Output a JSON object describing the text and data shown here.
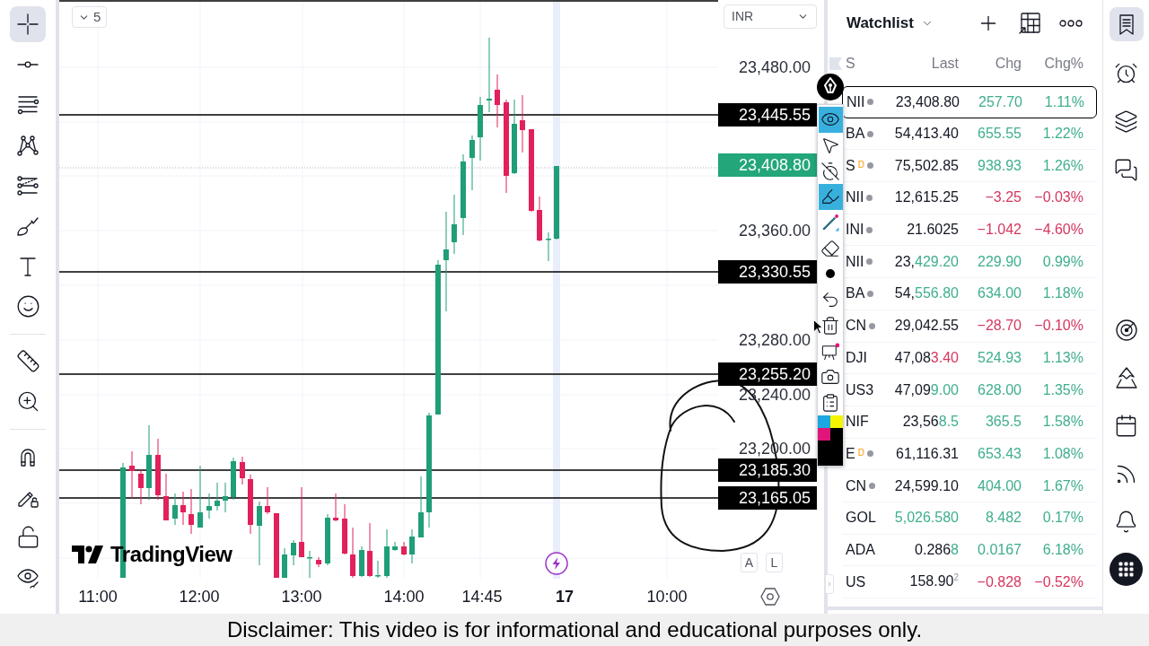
{
  "left_toolbar": {
    "groups": [
      [
        {
          "selected": true
        },
        {
          "selected": false
        },
        {
          "selected": false
        },
        {
          "selected": false
        },
        {
          "selected": false
        },
        {
          "selected": false
        },
        {
          "selected": false
        },
        {
          "selected": false
        }
      ],
      [
        {
          "selected": false
        },
        {
          "selected": false
        }
      ],
      [
        {
          "selected": false
        },
        {
          "selected": false
        },
        {
          "selected": false
        },
        {
          "selected": false
        }
      ]
    ]
  },
  "chart": {
    "interval": "5",
    "currency": "INR",
    "price_axis": [
      {
        "text": "23,480.00",
        "kind": "tick"
      },
      {
        "text": "23,445.55",
        "kind": "level"
      },
      {
        "text": "23,408.80",
        "kind": "last"
      },
      {
        "text": "23,360.00",
        "kind": "tick"
      },
      {
        "text": "23,330.55",
        "kind": "level"
      },
      {
        "text": "23,280.00",
        "kind": "tick"
      },
      {
        "text": "23,255.20",
        "kind": "level"
      },
      {
        "text": "23,240.00",
        "kind": "tick"
      },
      {
        "text": "23,200.00",
        "kind": "tick"
      },
      {
        "text": "23,185.30",
        "kind": "level"
      },
      {
        "text": "23,165.05",
        "kind": "level"
      }
    ],
    "time_axis": [
      {
        "text": "11:00",
        "kind": "time"
      },
      {
        "text": "12:00",
        "kind": "time"
      },
      {
        "text": "13:00",
        "kind": "time"
      },
      {
        "text": "14:00",
        "kind": "time"
      },
      {
        "text": "14:45",
        "kind": "time"
      },
      {
        "text": "17",
        "kind": "day"
      },
      {
        "text": "10:00",
        "kind": "time"
      }
    ],
    "scale_buttons": [
      "A",
      "L"
    ],
    "logo": "TradingView"
  },
  "annotation_toolbar": {
    "tools": [
      {
        "selected": true
      },
      {
        "selected": false
      },
      {
        "selected": false
      },
      {
        "selected": true
      },
      {
        "selected": false
      },
      {
        "selected": false
      },
      {
        "selected": false
      },
      {
        "selected": false
      },
      {
        "selected": false
      },
      {
        "selected": false
      },
      {
        "selected": false
      },
      {
        "selected": false
      }
    ]
  },
  "watchlist": {
    "title": "Watchlist",
    "columns": [
      "S",
      "Last",
      "Chg",
      "Chg%"
    ],
    "rows": [
      {
        "symbol": "NII",
        "status_dot": true,
        "last": [
          {
            "text": "23,408.80",
            "kind": "plain"
          }
        ],
        "chg": "257.70",
        "chg_pct": "1.11%",
        "gain": true,
        "selected": true
      },
      {
        "symbol": "BA",
        "status_dot": true,
        "last": [
          {
            "text": "54,413.40",
            "kind": "plain"
          }
        ],
        "chg": "655.55",
        "chg_pct": "1.22%",
        "gain": true,
        "selected": false
      },
      {
        "symbol": "S",
        "badge": "D",
        "status_dot": true,
        "last": [
          {
            "text": "75,502.85",
            "kind": "plain"
          }
        ],
        "chg": "938.93",
        "chg_pct": "1.26%",
        "gain": true,
        "selected": false
      },
      {
        "symbol": "NII",
        "status_dot": true,
        "last": [
          {
            "text": "12,615.25",
            "kind": "plain"
          }
        ],
        "chg": "−3.25",
        "chg_pct": "−0.03%",
        "gain": false,
        "selected": false
      },
      {
        "symbol": "INI",
        "status_dot": true,
        "last": [
          {
            "text": "21.6025",
            "kind": "plain"
          }
        ],
        "chg": "−1.042",
        "chg_pct": "−4.60%",
        "gain": false,
        "selected": false
      },
      {
        "symbol": "NII",
        "status_dot": true,
        "last": [
          {
            "text": "23,",
            "kind": "plain"
          },
          {
            "text": "429.20",
            "kind": "up"
          }
        ],
        "chg": "229.90",
        "chg_pct": "0.99%",
        "gain": true,
        "selected": false
      },
      {
        "symbol": "BA",
        "status_dot": true,
        "last": [
          {
            "text": "54,",
            "kind": "plain"
          },
          {
            "text": "556.80",
            "kind": "up"
          }
        ],
        "chg": "634.00",
        "chg_pct": "1.18%",
        "gain": true,
        "selected": false
      },
      {
        "symbol": "CN",
        "status_dot": true,
        "last": [
          {
            "text": "29,042.55",
            "kind": "plain"
          }
        ],
        "chg": "−28.70",
        "chg_pct": "−0.10%",
        "gain": false,
        "selected": false
      },
      {
        "symbol": "DJI",
        "status_dot": false,
        "last": [
          {
            "text": "47,08",
            "kind": "plain"
          },
          {
            "text": "3.40",
            "kind": "down"
          }
        ],
        "chg": "524.93",
        "chg_pct": "1.13%",
        "gain": true,
        "selected": false
      },
      {
        "symbol": "US3",
        "status_dot": false,
        "last": [
          {
            "text": "47,09",
            "kind": "plain"
          },
          {
            "text": "9.00",
            "kind": "up"
          }
        ],
        "chg": "628.00",
        "chg_pct": "1.35%",
        "gain": true,
        "selected": false
      },
      {
        "symbol": "NIF",
        "status_dot": false,
        "last": [
          {
            "text": "23,56",
            "kind": "plain"
          },
          {
            "text": "8.5",
            "kind": "up"
          }
        ],
        "chg": "365.5",
        "chg_pct": "1.58%",
        "gain": true,
        "selected": false
      },
      {
        "symbol": "E",
        "badge": "D",
        "status_dot": true,
        "last": [
          {
            "text": "61,116.31",
            "kind": "plain"
          }
        ],
        "chg": "653.43",
        "chg_pct": "1.08%",
        "gain": true,
        "selected": false
      },
      {
        "symbol": "CN",
        "status_dot": true,
        "last": [
          {
            "text": "24,599.10",
            "kind": "plain"
          }
        ],
        "chg": "404.00",
        "chg_pct": "1.67%",
        "gain": true,
        "selected": false
      },
      {
        "symbol": "GOL",
        "status_dot": false,
        "last": [
          {
            "text": "5,026.580",
            "kind": "up"
          }
        ],
        "chg": "8.482",
        "chg_pct": "0.17%",
        "gain": true,
        "selected": false
      },
      {
        "symbol": "ADA",
        "status_dot": false,
        "last": [
          {
            "text": "0.286",
            "kind": "plain"
          },
          {
            "text": "8",
            "kind": "up"
          }
        ],
        "chg": "0.0167",
        "chg_pct": "6.18%",
        "gain": true,
        "selected": false
      },
      {
        "symbol": "US",
        "status_dot": false,
        "last": [
          {
            "text": "158.90",
            "kind": "plain"
          },
          {
            "text": "2",
            "kind": "pip"
          }
        ],
        "chg": "−0.828",
        "chg_pct": "−0.52%",
        "gain": false,
        "selected": false
      }
    ]
  },
  "right_sidebar": {
    "groups": [
      [
        {
          "selected": true
        },
        {
          "selected": false
        },
        {
          "selected": false
        },
        {
          "selected": false
        }
      ],
      [
        {
          "selected": false
        },
        {
          "selected": false
        },
        {
          "selected": false
        },
        {
          "selected": false
        },
        {
          "selected": false
        },
        {
          "selected": false
        }
      ]
    ]
  },
  "caption": "Disclaimer: This video is for informational and educational purposes only."
}
